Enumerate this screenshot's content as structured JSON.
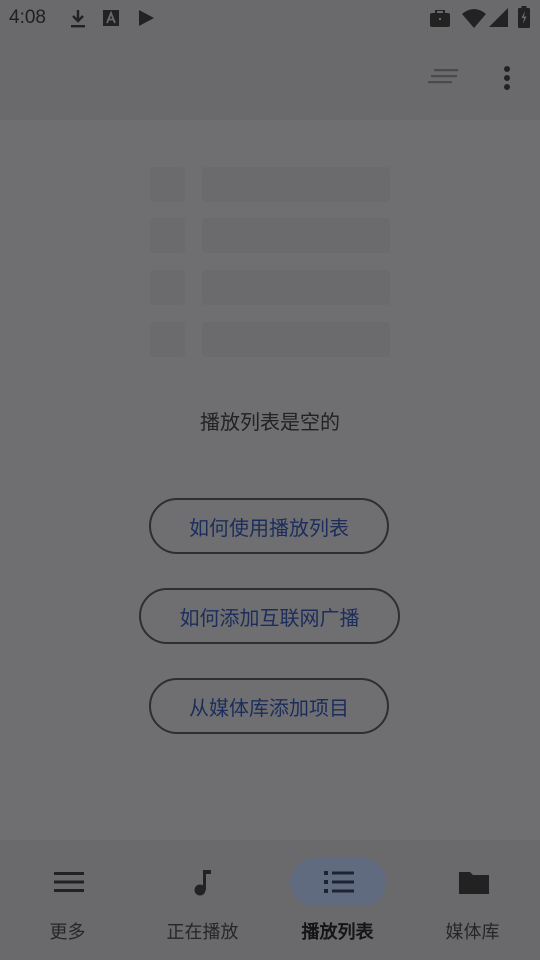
{
  "status_bar": {
    "time": "4:08",
    "left_icons": [
      "download-icon",
      "font-app-icon",
      "play-store-icon"
    ],
    "right_icons": [
      "work-briefcase-icon",
      "wifi-icon",
      "signal-icon",
      "battery-charging-icon"
    ]
  },
  "app_bar": {
    "icons": [
      "sort-icon",
      "more-vert-icon"
    ]
  },
  "empty_state": {
    "message": "播放列表是空的",
    "buttons": {
      "how_to_use": "如何使用播放列表",
      "how_to_add_radio": "如何添加互联网广播",
      "add_from_library": "从媒体库添加项目"
    }
  },
  "bottom_nav": {
    "items": [
      {
        "label": "更多",
        "icon": "menu-icon",
        "active": false
      },
      {
        "label": "正在播放",
        "icon": "music-note-icon",
        "active": false
      },
      {
        "label": "播放列表",
        "icon": "list-icon",
        "active": true
      },
      {
        "label": "媒体库",
        "icon": "folder-icon",
        "active": false
      }
    ]
  },
  "colors": {
    "overlay_background": "#6f6f71",
    "button_text": "#1c2d5c",
    "active_nav_pill": "#616b80"
  }
}
